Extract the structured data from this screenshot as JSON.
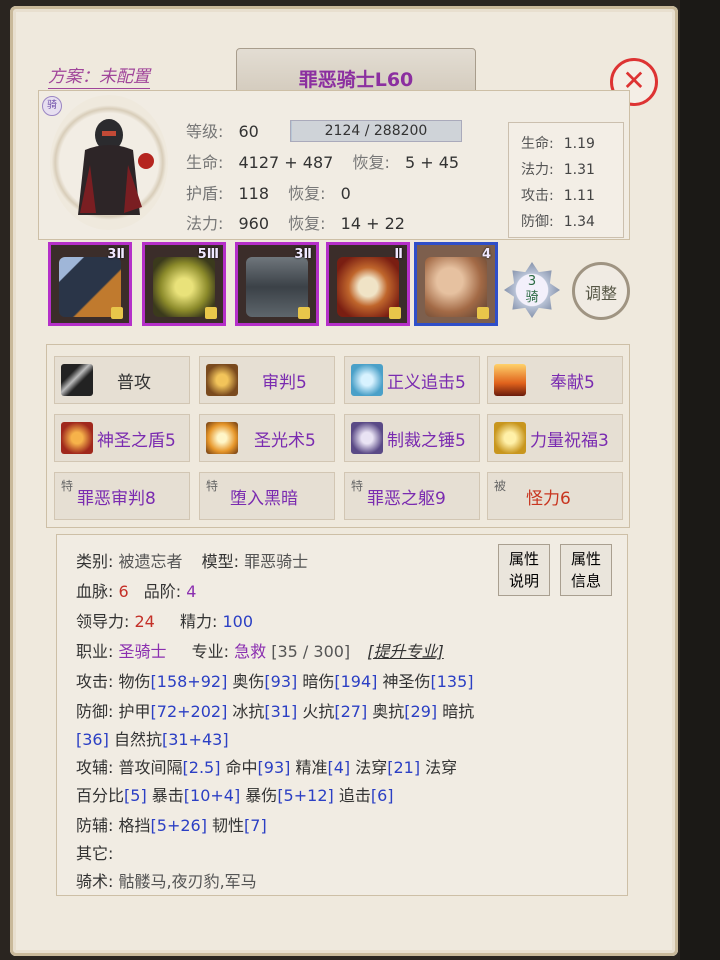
{
  "header": {
    "scheme_label": "方案：未配置",
    "title": "罪恶骑士L60",
    "close_glyph": "✕"
  },
  "portrait": {
    "ride_badge": "骑"
  },
  "stats": {
    "level_label": "等级:",
    "level_value": "60",
    "exp_text": "2124 / 288200",
    "exp_fraction": 0.0074,
    "hp_label": "生命:",
    "hp_value": "4127 + 487",
    "hp_regen_label": "恢复:",
    "hp_regen_value": "5 + 45",
    "shield_label": "护盾:",
    "shield_value": "118",
    "shield_regen_label": "恢复:",
    "shield_regen_value": "0",
    "mp_label": "法力:",
    "mp_value": "960",
    "mp_regen_label": "恢复:",
    "mp_regen_value": "14 + 22"
  },
  "growth": [
    {
      "label": "生命:",
      "value": "1.19"
    },
    {
      "label": "法力:",
      "value": "1.31"
    },
    {
      "label": "攻击:",
      "value": "1.11"
    },
    {
      "label": "防御:",
      "value": "1.34"
    }
  ],
  "equipment": [
    {
      "name": "sword",
      "level": "3Ⅱ"
    },
    {
      "name": "relic",
      "level": "5Ⅲ"
    },
    {
      "name": "armor",
      "level": "3Ⅱ"
    },
    {
      "name": "paw-charm",
      "level": "Ⅱ"
    },
    {
      "name": "horse",
      "level": "4"
    }
  ],
  "mount_medal": {
    "level": "3",
    "label": "骑"
  },
  "adjust_label": "调整",
  "skills": [
    {
      "tag": "",
      "label": "普攻",
      "color": "#333333"
    },
    {
      "tag": "",
      "label": "审判5",
      "color": "#7a2bb0"
    },
    {
      "tag": "",
      "label": "正义追击5",
      "color": "#7a2bb0"
    },
    {
      "tag": "",
      "label": "奉献5",
      "color": "#7a2bb0"
    },
    {
      "tag": "",
      "label": "神圣之盾5",
      "color": "#7a2bb0"
    },
    {
      "tag": "",
      "label": "圣光术5",
      "color": "#7a2bb0"
    },
    {
      "tag": "",
      "label": "制裁之锤5",
      "color": "#7a2bb0"
    },
    {
      "tag": "",
      "label": "力量祝福3",
      "color": "#7a2bb0"
    },
    {
      "tag": "特",
      "label": "罪恶审判8",
      "color": "#7a2bb0"
    },
    {
      "tag": "特",
      "label": "堕入黑暗",
      "color": "#7a2bb0"
    },
    {
      "tag": "特",
      "label": "罪恶之躯9",
      "color": "#7a2bb0"
    },
    {
      "tag": "被",
      "label": "怪力6",
      "color": "#c8351f"
    }
  ],
  "details": {
    "category_label": "类别:",
    "category_value": "被遗忘者",
    "model_label": "模型:",
    "model_value": "罪恶骑士",
    "bloodline_label": "血脉:",
    "bloodline_value": "6",
    "grade_label": "品阶:",
    "grade_value": "4",
    "leadership_label": "领导力:",
    "leadership_value": "24",
    "energy_label": "精力:",
    "energy_value": "100",
    "class_label": "职业:",
    "class_value": "圣骑士",
    "specialty_label": "专业:",
    "specialty_value": "急救",
    "specialty_progress": "[35 / 300]",
    "upgrade_link": "[提升专业]",
    "attack_label": "攻击:",
    "attack": [
      {
        "name": "物伤",
        "value": "[158+92]"
      },
      {
        "name": "奥伤",
        "value": "[93]"
      },
      {
        "name": "暗伤",
        "value": "[194]"
      },
      {
        "name": "神圣伤",
        "value": "[135]"
      }
    ],
    "defense_label": "防御:",
    "defense_line1": [
      {
        "name": "护甲",
        "value": "[72+202]"
      },
      {
        "name": "冰抗",
        "value": "[31]"
      },
      {
        "name": "火抗",
        "value": "[27]"
      },
      {
        "name": "奥抗",
        "value": "[29]"
      },
      {
        "name": "暗抗",
        "value": ""
      }
    ],
    "defense_line2_lead": "[36]",
    "defense_line2": [
      {
        "name": "自然抗",
        "value": "[31+43]"
      }
    ],
    "offaux_label": "攻辅:",
    "offaux_line1": [
      {
        "name": "普攻间隔",
        "value": "[2.5]"
      },
      {
        "name": "命中",
        "value": "[93]"
      },
      {
        "name": "精准",
        "value": "[4]"
      },
      {
        "name": "法穿",
        "value": "[21]"
      },
      {
        "name": "法穿",
        "value": ""
      }
    ],
    "offaux_line2": [
      {
        "name": "百分比",
        "value": "[5]"
      },
      {
        "name": "暴击",
        "value": "[10+4]"
      },
      {
        "name": "暴伤",
        "value": "[5+12]"
      },
      {
        "name": "追击",
        "value": "[6]"
      }
    ],
    "defaux_label": "防辅:",
    "defaux": [
      {
        "name": "格挡",
        "value": "[5+26]"
      },
      {
        "name": "韧性",
        "value": "[7]"
      }
    ],
    "other_label": "其它:",
    "riding_label": "骑术:",
    "riding_value": "骷髅马,夜刃豹,军马",
    "attr_explain_btn": [
      "属性",
      "说明"
    ],
    "attr_info_btn": [
      "属性",
      "信息"
    ]
  }
}
